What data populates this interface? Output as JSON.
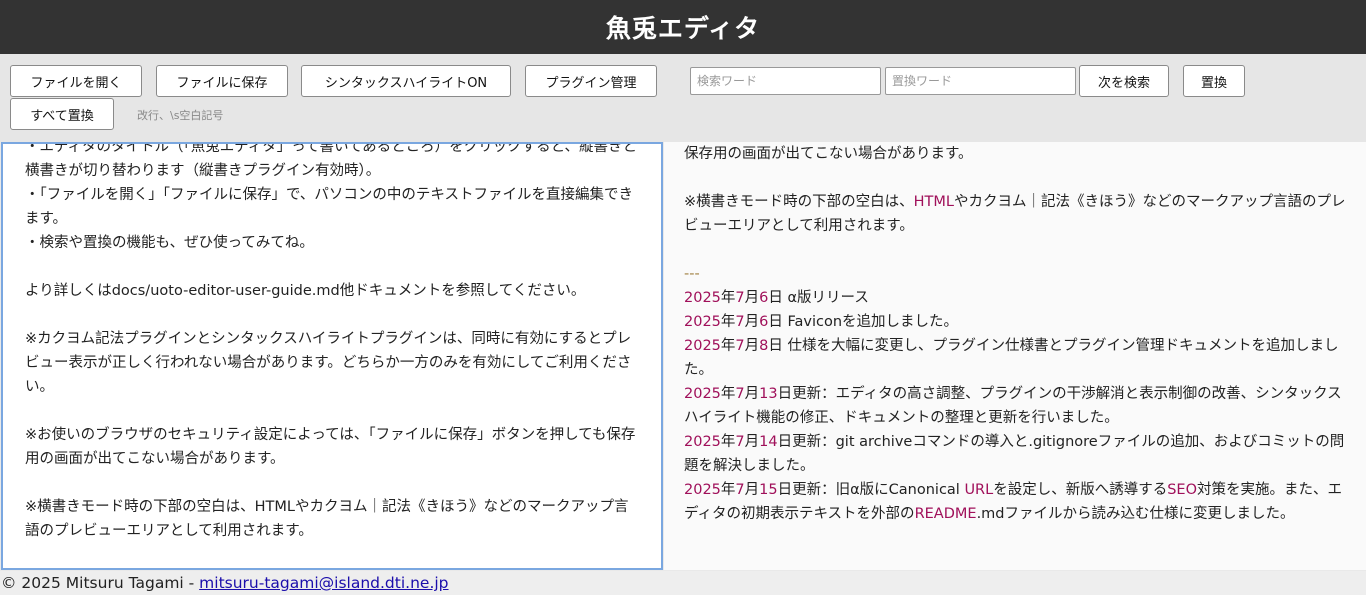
{
  "app": {
    "title": "魚兎エディタ"
  },
  "toolbar": {
    "open_label": "ファイルを開く",
    "save_label": "ファイルに保存",
    "syntax_label": "シンタックスハイライトON",
    "plugin_label": "プラグイン管理",
    "search_placeholder": "検索ワード",
    "replace_placeholder": "置換ワード",
    "find_next_label": "次を検索",
    "replace_label": "置換",
    "replace_all_label": "すべて置換",
    "hint": "改行、\\s空白記号"
  },
  "editor": {
    "lines": [
      "・エディタのタイトル（「魚兎エディタ」って書いてあるところ）をクリックすると、縦書きと横書きが切り替わります（縦書きプラグイン有効時）。",
      "・「ファイルを開く」「ファイルに保存」で、パソコンの中のテキストファイルを直接編集できます。",
      "・検索や置換の機能も、ぜひ使ってみてね。",
      "",
      "より詳しくはdocs/uoto-editor-user-guide.md他ドキュメントを参照してください。",
      "",
      "※カクヨム記法プラグインとシンタックスハイライトプラグインは、同時に有効にするとプレビュー表示が正しく行われない場合があります。どちらか一方のみを有効にしてご利用ください。",
      "",
      "※お使いのブラウザのセキュリティ設定によっては、「ファイルに保存」ボタンを押しても保存用の画面が出てこない場合があります。",
      "",
      "※横書きモード時の下部の空白は、HTMLやカクヨム｜記法《きほう》などのマークアップ言語のプレビューエリアとして利用されます。"
    ]
  },
  "preview": {
    "line1": "保存用の画面が出てこない場合があります。",
    "note_a": "※横書きモード時の下部の空白は、",
    "note_html": "HTML",
    "note_b": "やカクヨム｜記法《きほう》などのマークアップ言語のプレビューエリアとして利用されます。",
    "hr": "---",
    "changelog": [
      {
        "year": "2025",
        "nen": "年",
        "month": "7",
        "gatsu": "月",
        "day": "6",
        "text": "日 α版リリース"
      },
      {
        "year": "2025",
        "nen": "年",
        "month": "7",
        "gatsu": "月",
        "day": "6",
        "text": "日 Faviconを追加しました。"
      },
      {
        "year": "2025",
        "nen": "年",
        "month": "7",
        "gatsu": "月",
        "day": "8",
        "text": "日 仕様を大幅に変更し、プラグイン仕様書とプラグイン管理ドキュメントを追加しました。"
      },
      {
        "year": "2025",
        "nen": "年",
        "month": "7",
        "gatsu": "月",
        "day": "13",
        "text": "日更新：エディタの高さ調整、プラグインの干渉解消と表示制御の改善、シンタックスハイライト機能の修正、ドキュメントの整理と更新を行いました。"
      },
      {
        "year": "2025",
        "nen": "年",
        "month": "7",
        "gatsu": "月",
        "day": "14",
        "text": "日更新：git archiveコマンドの導入と.gitignoreファイルの追加、およびコミットの問題を解決しました。"
      }
    ],
    "last": {
      "year": "2025",
      "nen": "年",
      "month": "7",
      "gatsu": "月",
      "day": "15",
      "t1": "日更新：旧α版にCanonical ",
      "url": "URL",
      "t2": "を設定し、新版へ誘導する",
      "seo": "SEO",
      "t3": "対策を実施。また、エディタの初期表示テキストを外部の",
      "readme": "README",
      "t4": ".mdファイルから読み込む仕様に変更しました。"
    }
  },
  "footer": {
    "copyright": "© 2025 Mitsuru Tagami - ",
    "email": "mitsuru-tagami@island.dti.ne.jp"
  },
  "colors": {
    "title_bg": "#333333",
    "accent_pink": "#a0105a",
    "editor_border": "#7aa7e0",
    "link": "#1a0dab"
  }
}
